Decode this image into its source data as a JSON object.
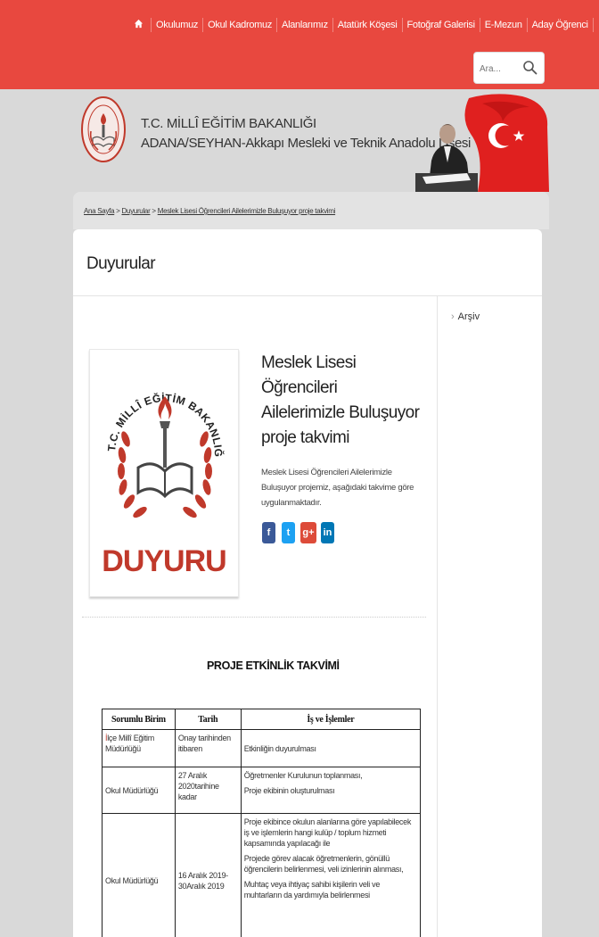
{
  "nav": {
    "home_icon": "home-icon",
    "items": [
      "Okulumuz",
      "Okul Kadromuz",
      "Alanlarımız",
      "Atatürk Köşesi",
      "Fotoğraf Galerisi",
      "E-Mezun",
      "Aday Öğrenci"
    ],
    "phone_icon": "phone-icon"
  },
  "search": {
    "placeholder": "Ara..."
  },
  "banner": {
    "line1": "T.C. MİLLÎ EĞİTİM BAKANLIĞI",
    "line2": "ADANA/SEYHAN-Akkapı Mesleki ve Teknik Anadolu Lisesi"
  },
  "breadcrumb": {
    "home": "Ana Sayfa",
    "section": "Duyurular",
    "current": "Meslek Lisesi Öğrencileri Ailelerimizle Buluşuyor proje takvimi",
    "separator": ">"
  },
  "page": {
    "title": "Duyurular",
    "sidebar_archive": "Arşiv"
  },
  "announcement": {
    "image_caption": "DUYURU",
    "image_arc_text": "T.C. MİLLÎ EĞİTİM BAKANLIĞI",
    "title": "Meslek Lisesi Öğrencileri Ailelerimizle Buluşuyor proje takvimi",
    "text": "Meslek Lisesi Öğrencileri Ailelerimizle Buluşuyor projemiz, aşağıdaki takvime göre uygulanmaktadır.",
    "share": {
      "facebook": "f",
      "twitter": "t",
      "googleplus": "g+",
      "linkedin": "in"
    }
  },
  "schedule": {
    "heading": "PROJE ETKİNLİK TAKVİMİ",
    "headers": [
      "Sorumlu Birim",
      "Tarih",
      "İş ve İşlemler"
    ],
    "rows": [
      {
        "unit_first": "İ",
        "unit_rest": "lçe Millî Eğitim Müdürlüğü",
        "date": "Onay tarihinden itibaren",
        "tasks": [
          "Etkinliğin duyurulması"
        ]
      },
      {
        "unit": "Okul Müdürlüğü",
        "date": "27 Aralık 2020tarihine kadar",
        "tasks": [
          "Öğretmenler Kurulunun toplanması,",
          "Proje ekibinin oluşturulması"
        ]
      },
      {
        "unit": "Okul Müdürlüğü",
        "date": "16 Aralık 2019-30Aralık 2019",
        "tasks": [
          "Proje ekibince okulun alanlarına göre yapılabilecek iş ve işlemlerin hangi kulüp / toplum hizmeti kapsamında yapılacağı ile",
          "Projede görev alacak öğretmenlerin, gönüllü öğrencilerin belirlenmesi, veli izinlerinin alınması,",
          "Muhtaç veya ihtiyaç sahibi kişilerin veli ve muhtarların da yardımıyla belirlenmesi"
        ]
      }
    ]
  },
  "colors": {
    "header_red": "#e8483f",
    "duyuru_red": "#c0392b",
    "page_bg": "#d9d9d9"
  }
}
